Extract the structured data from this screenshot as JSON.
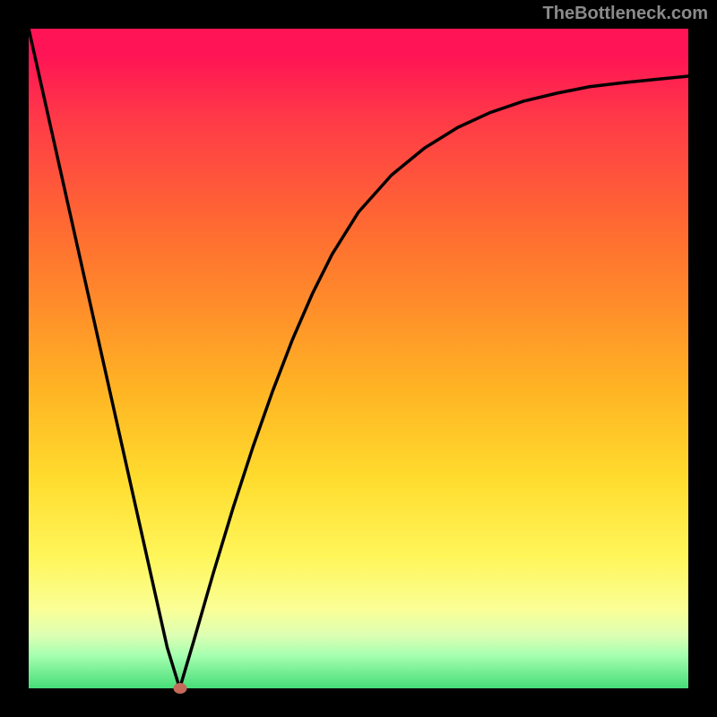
{
  "attribution": "TheBottleneck.com",
  "colors": {
    "frame": "#000000",
    "attribution_text": "#8b8b8b",
    "curve": "#000000",
    "marker": "#c46a5b",
    "gradient_stops": [
      {
        "pct": 0,
        "hex": "#ff1455"
      },
      {
        "pct": 4,
        "hex": "#ff1455"
      },
      {
        "pct": 14,
        "hex": "#ff3b47"
      },
      {
        "pct": 30,
        "hex": "#ff6a32"
      },
      {
        "pct": 42,
        "hex": "#ff8d2a"
      },
      {
        "pct": 55,
        "hex": "#ffb524"
      },
      {
        "pct": 68,
        "hex": "#ffdb2d"
      },
      {
        "pct": 80,
        "hex": "#fff65a"
      },
      {
        "pct": 88,
        "hex": "#faff96"
      },
      {
        "pct": 92,
        "hex": "#dcffb3"
      },
      {
        "pct": 95,
        "hex": "#a6ffb0"
      },
      {
        "pct": 100,
        "hex": "#46dd78"
      }
    ]
  },
  "chart_data": {
    "type": "line",
    "title": "",
    "xlabel": "",
    "ylabel": "",
    "x_range": [
      0,
      1
    ],
    "y_range": [
      0,
      1
    ],
    "series": [
      {
        "name": "bottleneck-curve",
        "x": [
          0.0,
          0.03,
          0.06,
          0.09,
          0.12,
          0.15,
          0.18,
          0.21,
          0.229,
          0.25,
          0.28,
          0.31,
          0.34,
          0.37,
          0.4,
          0.43,
          0.46,
          0.5,
          0.55,
          0.6,
          0.65,
          0.7,
          0.75,
          0.8,
          0.85,
          0.9,
          0.95,
          1.0
        ],
        "y": [
          1.0,
          0.866,
          0.732,
          0.598,
          0.464,
          0.33,
          0.196,
          0.062,
          0.0,
          0.071,
          0.175,
          0.274,
          0.366,
          0.451,
          0.529,
          0.598,
          0.658,
          0.722,
          0.778,
          0.819,
          0.85,
          0.873,
          0.89,
          0.902,
          0.912,
          0.918,
          0.923,
          0.928
        ]
      }
    ],
    "marker": {
      "x": 0.229,
      "y": 0.0
    }
  }
}
